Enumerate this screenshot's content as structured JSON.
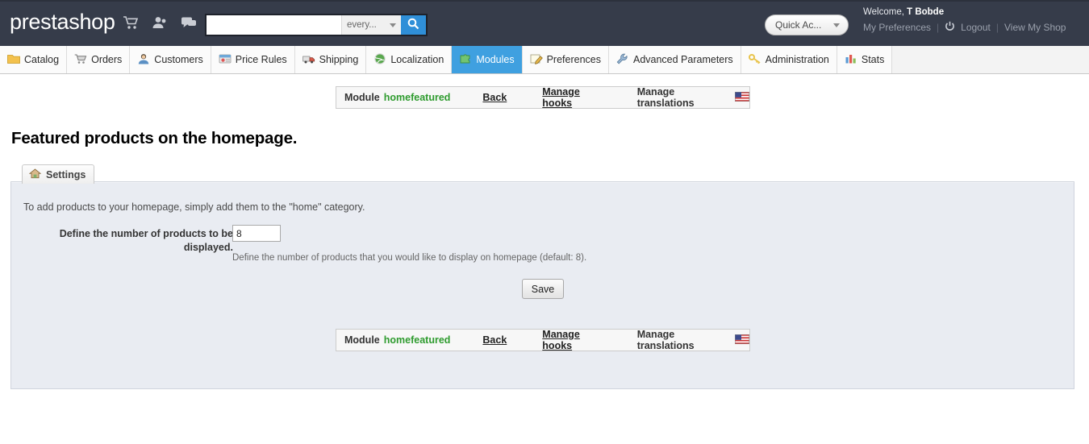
{
  "header": {
    "logo": "prestashop",
    "icons": [
      {
        "name": "cart-icon"
      },
      {
        "name": "customers-icon"
      },
      {
        "name": "chat-icon"
      }
    ],
    "search": {
      "value": "",
      "placeholder": "",
      "scope_label": "every...",
      "button_icon": "search-icon"
    },
    "quick_access": {
      "label": "Quick Ac...",
      "caret_icon": "chevron-down-icon"
    },
    "welcome_prefix": "Welcome, ",
    "user_name": "T Bobde",
    "links": {
      "preferences": "My Preferences",
      "logout": "Logout",
      "view_shop": "View My Shop",
      "power_icon": "power-icon",
      "separator": "|"
    }
  },
  "nav": {
    "tabs": [
      {
        "label": "Catalog",
        "icon": "folder-icon",
        "active": false
      },
      {
        "label": "Orders",
        "icon": "cart-icon",
        "active": false
      },
      {
        "label": "Customers",
        "icon": "person-icon",
        "active": false
      },
      {
        "label": "Price Rules",
        "icon": "tag-icon",
        "active": false
      },
      {
        "label": "Shipping",
        "icon": "truck-icon",
        "active": false
      },
      {
        "label": "Localization",
        "icon": "globe-icon",
        "active": false
      },
      {
        "label": "Modules",
        "icon": "puzzle-icon",
        "active": true
      },
      {
        "label": "Preferences",
        "icon": "pencil-icon",
        "active": false
      },
      {
        "label": "Advanced Parameters",
        "icon": "wrench-icon",
        "active": false
      },
      {
        "label": "Administration",
        "icon": "key-icon",
        "active": false
      },
      {
        "label": "Stats",
        "icon": "barchart-icon",
        "active": false
      }
    ]
  },
  "module_bar": {
    "title": "Module",
    "module_name": "homefeatured",
    "back": "Back",
    "manage_hooks": "Manage hooks",
    "manage_translations": "Manage translations",
    "flag_icon": "us-flag-icon"
  },
  "main": {
    "page_title": "Featured products on the homepage.",
    "panel_tab": "Settings",
    "panel_tab_icon": "home-icon",
    "note": "To add products to your homepage, simply add them to the \"home\" category.",
    "field_label": "Define the number of products to be displayed.",
    "field_value": "8",
    "field_hint": "Define the number of products that you would like to display on homepage (default: 8).",
    "save_label": "Save"
  },
  "colors": {
    "header_bg": "#363c4a",
    "active_tab": "#3fa0e0",
    "module_name_green": "#2e9b2e",
    "panel_bg": "#e9ecf2",
    "search_button": "#2f8fd8"
  }
}
